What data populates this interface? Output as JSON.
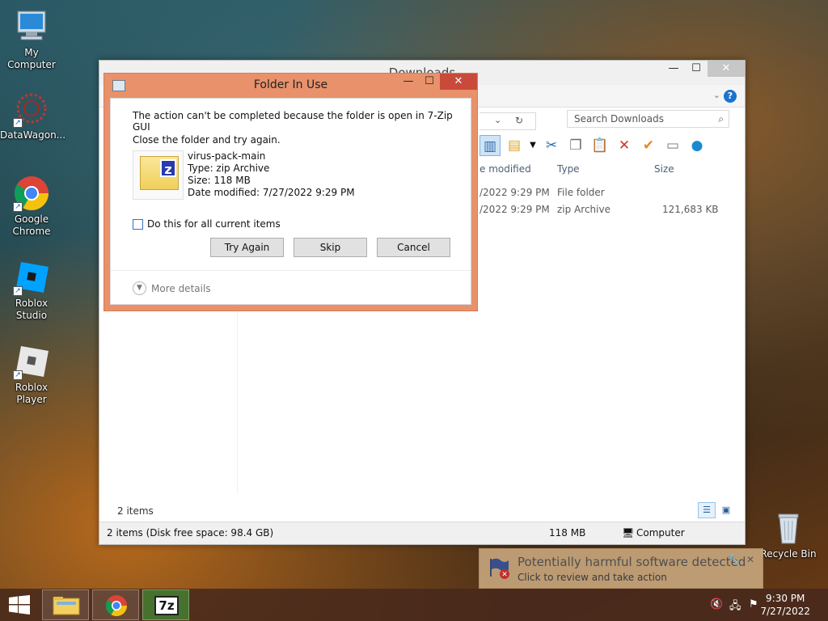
{
  "desktop": {
    "icons": [
      {
        "label": "My Computer"
      },
      {
        "label": "DataWagon..."
      },
      {
        "label": "Google Chrome"
      },
      {
        "label": "Roblox Studio"
      },
      {
        "label": "Roblox Player"
      },
      {
        "label": "Recycle Bin"
      }
    ]
  },
  "explorer": {
    "title": "Downloads",
    "search_placeholder": "Search Downloads",
    "columns": {
      "date_modified": "e modified",
      "type": "Type",
      "size": "Size"
    },
    "rows": [
      {
        "date": "/2022 9:29 PM",
        "type": "File folder",
        "size": ""
      },
      {
        "date": "/2022 9:29 PM",
        "type": "zip Archive",
        "size": "121,683 KB"
      }
    ],
    "items_count": "2 items",
    "status": {
      "left": "2 items (Disk free space: 98.4 GB)",
      "size": "118 MB",
      "location": "Computer"
    },
    "help": "?"
  },
  "dialog": {
    "title": "Folder In Use",
    "message": "The action can't be completed because the folder is open in 7-Zip GUI",
    "sub": "Close the folder and try again.",
    "file": {
      "name": "virus-pack-main",
      "type": "Type: zip Archive",
      "size": "Size: 118 MB",
      "date": "Date modified: 7/27/2022 9:29 PM"
    },
    "checkbox_label": "Do this for all current items",
    "buttons": {
      "try_again": "Try Again",
      "skip": "Skip",
      "cancel": "Cancel"
    },
    "more_details": "More details"
  },
  "notification": {
    "title": "Potentially harmful software detected",
    "subtitle": "Click to review and take action"
  },
  "taskbar": {
    "items": [
      "file-explorer",
      "google-chrome",
      "7-zip"
    ],
    "clock_time": "9:30 PM",
    "clock_date": "7/27/2022",
    "seven_zip_label": "7z"
  }
}
